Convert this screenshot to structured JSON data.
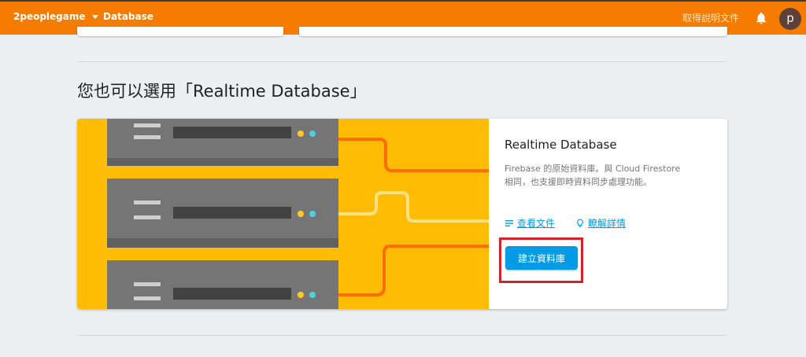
{
  "topbar": {
    "project_name": "2peoplegame",
    "page": "Database",
    "help_link": "取得說明文件",
    "avatar_initial": "p",
    "accent": "#f57c00"
  },
  "section": {
    "title": "您也可以選用「Realtime Database」"
  },
  "card": {
    "title": "Realtime Database",
    "description": "Firebase 的原始資料庫。與 Cloud Firestore 相同，也支援即時資料同步處理功能。",
    "docs_link": "查看文件",
    "docs_icon": "notes-icon",
    "learn_link": "瞭解詳情",
    "learn_icon": "lightbulb-icon",
    "create_button": "建立資料庫",
    "button_color": "#039be5",
    "highlight_color": "#d8202a"
  }
}
